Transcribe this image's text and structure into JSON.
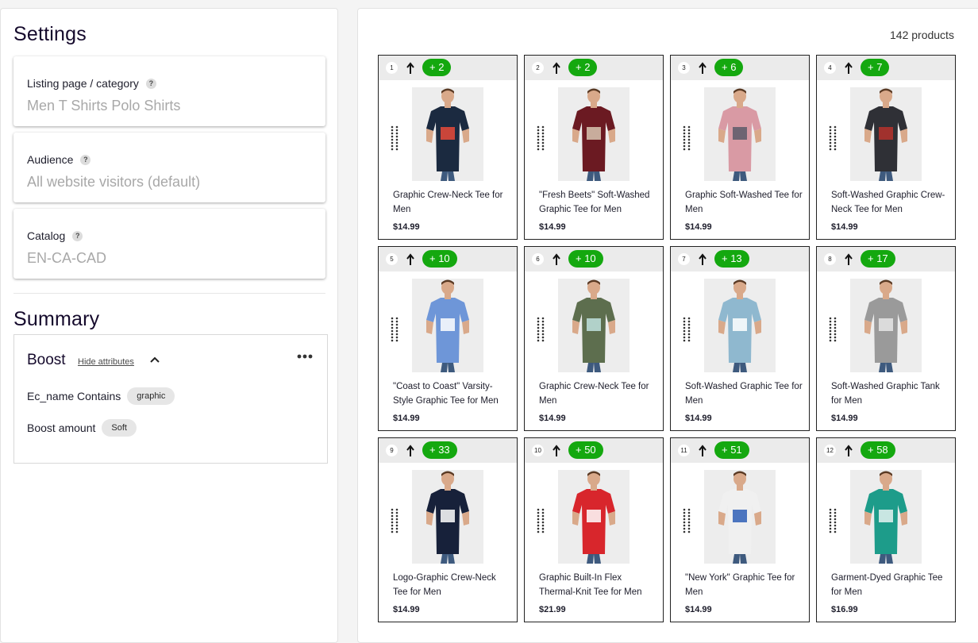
{
  "settings": {
    "title": "Settings",
    "fields": [
      {
        "label": "Listing page / category",
        "value": "Men T Shirts Polo Shirts"
      },
      {
        "label": "Audience",
        "value": "All website visitors (default)"
      },
      {
        "label": "Catalog",
        "value": "EN-CA-CAD"
      }
    ],
    "help_icon": "?"
  },
  "summary": {
    "title": "Summary",
    "boost": {
      "title": "Boost",
      "hide_attributes": "Hide attributes",
      "more_icon": "•••",
      "rows": [
        {
          "label": "Ec_name Contains",
          "pill": "graphic"
        },
        {
          "label": "Boost amount",
          "pill": "Soft"
        }
      ]
    }
  },
  "results": {
    "count": "142 products",
    "products": [
      {
        "rank": "1",
        "boost": "+ 2",
        "name": "Graphic Crew-Neck Tee for Men",
        "price": "$14.99",
        "shirt": "#1b2a40",
        "accent": "#e84a3a"
      },
      {
        "rank": "2",
        "boost": "+ 2",
        "name": "\"Fresh Beets\" Soft-Washed Graphic Tee for Men",
        "price": "$14.99",
        "shirt": "#6b1a22",
        "accent": "#d8c7b2"
      },
      {
        "rank": "3",
        "boost": "+ 6",
        "name": "Graphic Soft-Washed Tee for Men",
        "price": "$14.99",
        "shirt": "#d99aa4",
        "accent": "#5a5a6a"
      },
      {
        "rank": "4",
        "boost": "+ 7",
        "name": "Soft-Washed Graphic Crew-Neck Tee for Men",
        "price": "$14.99",
        "shirt": "#2f3036",
        "accent": "#b5312b"
      },
      {
        "rank": "5",
        "boost": "+ 10",
        "name": "\"Coast to Coast\" Varsity-Style Graphic Tee for Men",
        "price": "$14.99",
        "shirt": "#6e96d8",
        "accent": "#ffffff"
      },
      {
        "rank": "6",
        "boost": "+ 10",
        "name": "Graphic Crew-Neck Tee for Men",
        "price": "$14.99",
        "shirt": "#5d6e4e",
        "accent": "#bfe3df"
      },
      {
        "rank": "7",
        "boost": "+ 13",
        "name": "Soft-Washed Graphic Tee for Men",
        "price": "$14.99",
        "shirt": "#8fb8cf",
        "accent": "#ffffff"
      },
      {
        "rank": "8",
        "boost": "+ 17",
        "name": "Soft-Washed Graphic Tank for Men",
        "price": "$14.99",
        "shirt": "#9a9a9a",
        "accent": "#e6e6e6"
      },
      {
        "rank": "9",
        "boost": "+ 33",
        "name": "Logo-Graphic Crew-Neck Tee for Men",
        "price": "$14.99",
        "shirt": "#17213a",
        "accent": "#ffffff"
      },
      {
        "rank": "10",
        "boost": "+ 50",
        "name": "Graphic Built-In Flex Thermal-Knit Tee for Men",
        "price": "$21.99",
        "shirt": "#d8262c",
        "accent": "#ffffff"
      },
      {
        "rank": "11",
        "boost": "+ 51",
        "name": "\"New York\" Graphic Tee for Men",
        "price": "$14.99",
        "shirt": "#f0f0f0",
        "accent": "#2f5fb6"
      },
      {
        "rank": "12",
        "boost": "+ 58",
        "name": "Garment-Dyed Graphic Tee for Men",
        "price": "$16.99",
        "shirt": "#1d9c8a",
        "accent": "#e6f3f1"
      }
    ]
  },
  "colors": {
    "boost_green": "#14a80f",
    "title_ink": "#150a2c",
    "placeholder": "#a8a8a8"
  }
}
